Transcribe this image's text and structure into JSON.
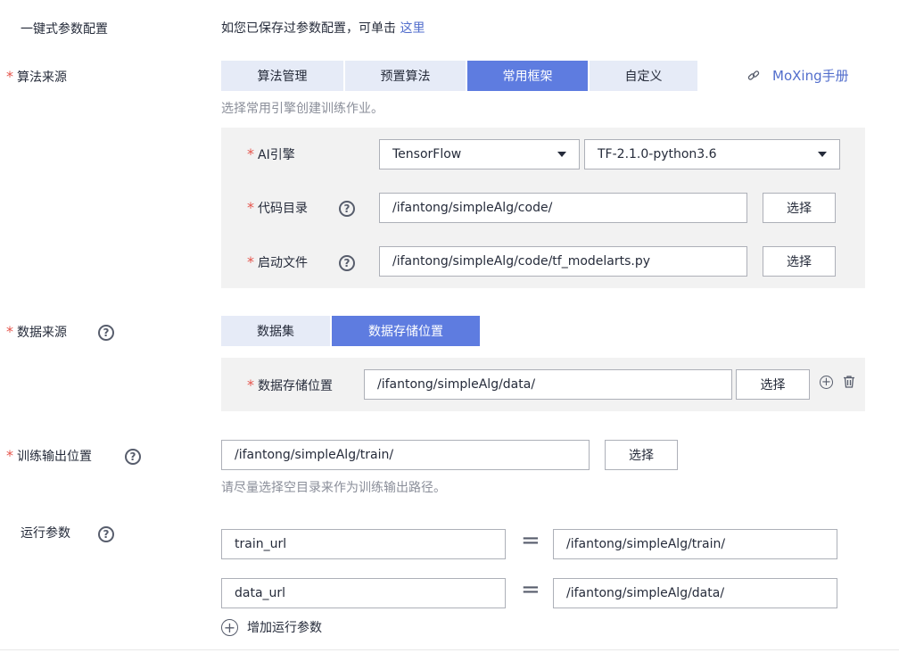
{
  "one_click": {
    "label": "一键式参数配置",
    "prompt": "如您已保存过参数配置，可单击",
    "link": "这里"
  },
  "algo_source": {
    "label": "算法来源",
    "tabs": [
      {
        "label": "算法管理",
        "active": false
      },
      {
        "label": "预置算法",
        "active": false
      },
      {
        "label": "常用框架",
        "active": true
      },
      {
        "label": "自定义",
        "active": false
      }
    ],
    "moxing_link": "MoXing手册",
    "hint": "选择常用引擎创建训练作业。",
    "ai_engine": {
      "label": "AI引擎",
      "engine_value": "TensorFlow",
      "version_value": "TF-2.1.0-python3.6"
    },
    "code_dir": {
      "label": "代码目录",
      "value": "/ifantong/simpleAlg/code/",
      "button": "选择"
    },
    "boot_file": {
      "label": "启动文件",
      "value": "/ifantong/simpleAlg/code/tf_modelarts.py",
      "button": "选择"
    }
  },
  "data_source": {
    "label": "数据来源",
    "tabs": [
      {
        "label": "数据集",
        "active": false
      },
      {
        "label": "数据存储位置",
        "active": true
      }
    ],
    "storage": {
      "label": "数据存储位置",
      "value": "/ifantong/simpleAlg/data/",
      "button": "选择"
    }
  },
  "train_output": {
    "label": "训练输出位置",
    "value": "/ifantong/simpleAlg/train/",
    "button": "选择",
    "hint": "请尽量选择空目录来作为训练输出路径。"
  },
  "run_params": {
    "label": "运行参数",
    "rows": [
      {
        "key": "train_url",
        "equals": "=",
        "value": "/ifantong/simpleAlg/train/"
      },
      {
        "key": "data_url",
        "equals": "=",
        "value": "/ifantong/simpleAlg/data/"
      }
    ],
    "add_label": "增加运行参数"
  },
  "colors": {
    "accent": "#5e7ce0",
    "tab_bg": "#e6ebf7",
    "required": "#e5544b",
    "link": "#526ecc",
    "panel_bg": "#f2f2f2"
  }
}
